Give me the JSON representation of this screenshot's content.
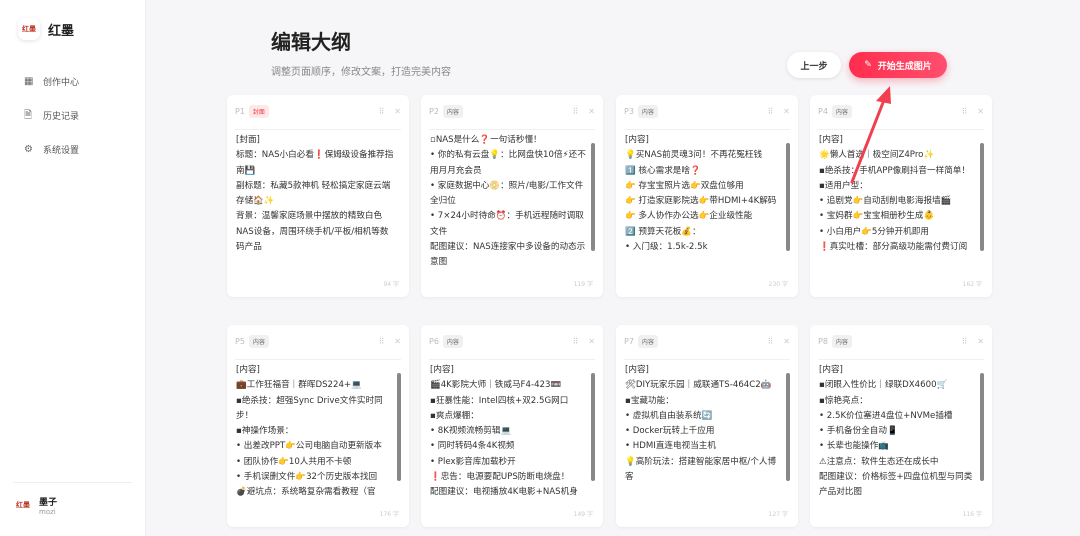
{
  "sidebar": {
    "logo": "红墨",
    "brand": "红墨",
    "items": [
      {
        "label": "创作中心",
        "icon": "grid-icon"
      },
      {
        "label": "历史记录",
        "icon": "document-icon"
      },
      {
        "label": "系统设置",
        "icon": "gear-icon"
      }
    ],
    "user": {
      "avatar": "红墨",
      "name": "墨子",
      "id": "mozi"
    }
  },
  "header": {
    "title": "编辑大纲",
    "subtitle": "调整页面顺序，修改文案，打造完美内容",
    "prev_label": "上一步",
    "generate_label": "开始生成图片"
  },
  "colors": {
    "accent": "#ff2d4d",
    "annotation_arrow": "#f04050"
  },
  "pages": [
    {
      "num": "P1",
      "tag": "封面",
      "count": "94 字",
      "lines": [
        "[封面]",
        "标题：NAS小白必看❗保姆级设备推荐指南💾",
        "副标题：私藏5款神机 轻松搞定家庭云端存储🏠✨",
        "背景：温馨家庭场景中摆放的精致白色NAS设备，周围环绕手机/平板/相机等数码产品"
      ]
    },
    {
      "num": "P2",
      "tag": "内容",
      "count": "119 字",
      "lines": [
        "▫NAS是什么❓一句话秒懂！",
        "• 你的私有云盘💡：比网盘快10倍⚡还不用月月充会员",
        "• 家庭数据中心📀：照片/电影/工作文件全归位",
        "• 7×24小时待命⏰：手机远程随时调取文件",
        "配图建议：NAS连接家中多设备的动态示意图"
      ]
    },
    {
      "num": "P3",
      "tag": "内容",
      "count": "230 字",
      "lines": [
        "[内容]",
        "💡买NAS前灵魂3问！不再花冤枉钱",
        "1️⃣ 核心需求是啥❓",
        "👉 存宝宝照片选👉双盘位够用",
        "👉 打造家庭影院选👉带HDMI+4K解码",
        "👉 多人协作办公选👉企业级性能",
        "2️⃣ 预算天花板💰：",
        "• 入门级：1.5k-2.5k"
      ]
    },
    {
      "num": "P4",
      "tag": "内容",
      "count": "162 字",
      "lines": [
        "[内容]",
        "🌟懒人首选｜极空间Z4Pro✨",
        "▪绝杀技：手机APP像刷抖音一样简单！",
        "▪适用户型：",
        "• 追剧党👉自动刮削电影海报墙🎬",
        "• 宝妈群👉宝宝相册秒生成👶",
        "• 小白用户👉5分钟开机即用",
        "❗真实吐槽：部分高级功能需付费订阅"
      ]
    },
    {
      "num": "P5",
      "tag": "内容",
      "count": "176 字",
      "lines": [
        "[内容]",
        "💼工作狂福音｜群晖DS224+💻",
        "▪绝杀技：超强Sync Drive文件实时同步！",
        "▪神操作场景：",
        "• 出差改PPT👉公司电脑自动更新版本",
        "• 团队协作👉10人共用不卡顿",
        "• 手机误删文件👉32个历史版本找回",
        "💣避坑点：系统略复杂需看教程（官"
      ]
    },
    {
      "num": "P6",
      "tag": "内容",
      "count": "149 字",
      "lines": [
        "[内容]",
        "🎬4K影院大师｜铁威马F4-423📼",
        "▪狂暴性能：Intel四核+双2.5G网口",
        "▪爽点爆棚：",
        "• 8K视频流畅剪辑💻",
        "• 同时转码4条4K视频",
        "• Plex影音库加载秒开",
        "❗忠告：电源要配UPS防断电烧盘！",
        "配图建议：电视播放4K电影+NAS机身"
      ]
    },
    {
      "num": "P7",
      "tag": "内容",
      "count": "127 字",
      "lines": [
        "[内容]",
        "🛠DIY玩家乐园｜威联通TS-464C2🤖",
        "▪宝藏功能：",
        "• 虚拟机自由装系统🔄",
        "• Docker玩转上千应用",
        "• HDMI直连电视当主机",
        "💡高阶玩法：搭建智能家居中枢/个人博客"
      ]
    },
    {
      "num": "P8",
      "tag": "内容",
      "count": "116 字",
      "lines": [
        "[内容]",
        "▪闭眼入性价比｜绿联DX4600🛒",
        "▪惊艳亮点：",
        "• 2.5K价位塞进4盘位+NVMe插槽",
        "• 手机备份全自动📱",
        "• 长辈也能操作📺",
        "⚠注意点：软件生态还在成长中",
        "配图建议：价格标签+四盘位机型与同类产品对比图"
      ]
    }
  ]
}
